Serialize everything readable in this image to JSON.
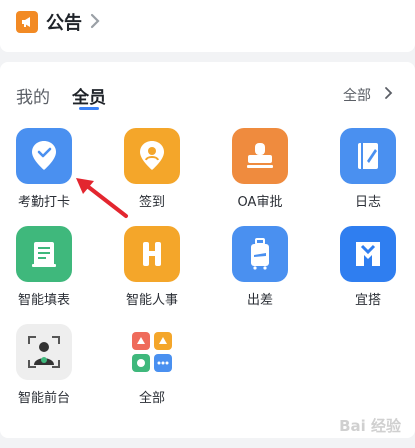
{
  "notice": {
    "title": "公告",
    "icon": "megaphone-icon"
  },
  "tabs": [
    {
      "label": "我的",
      "active": false
    },
    {
      "label": "全员",
      "active": true
    }
  ],
  "all_link": "全部",
  "apps": [
    {
      "label": "考勤打卡",
      "icon": "location-check-icon",
      "color": "#4a90f0"
    },
    {
      "label": "签到",
      "icon": "location-pin-icon",
      "color": "#f4a62a"
    },
    {
      "label": "OA审批",
      "icon": "stamp-icon",
      "color": "#ef8b3e"
    },
    {
      "label": "日志",
      "icon": "notebook-pen-icon",
      "color": "#4a90f0"
    },
    {
      "label": "智能填表",
      "icon": "form-sheet-icon",
      "color": "#3fb87c"
    },
    {
      "label": "智能人事",
      "icon": "hr-h-icon",
      "color": "#f4a62a"
    },
    {
      "label": "出差",
      "icon": "suitcase-plane-icon",
      "color": "#4a90f0"
    },
    {
      "label": "宜搭",
      "icon": "yida-logo-icon",
      "color": "#2f7ef0"
    },
    {
      "label": "智能前台",
      "icon": "face-scan-icon",
      "color": "#eeeeee"
    },
    {
      "label": "全部",
      "icon": "grid-apps-icon",
      "color": "#ffffff"
    }
  ],
  "watermark": "Bai 经验"
}
